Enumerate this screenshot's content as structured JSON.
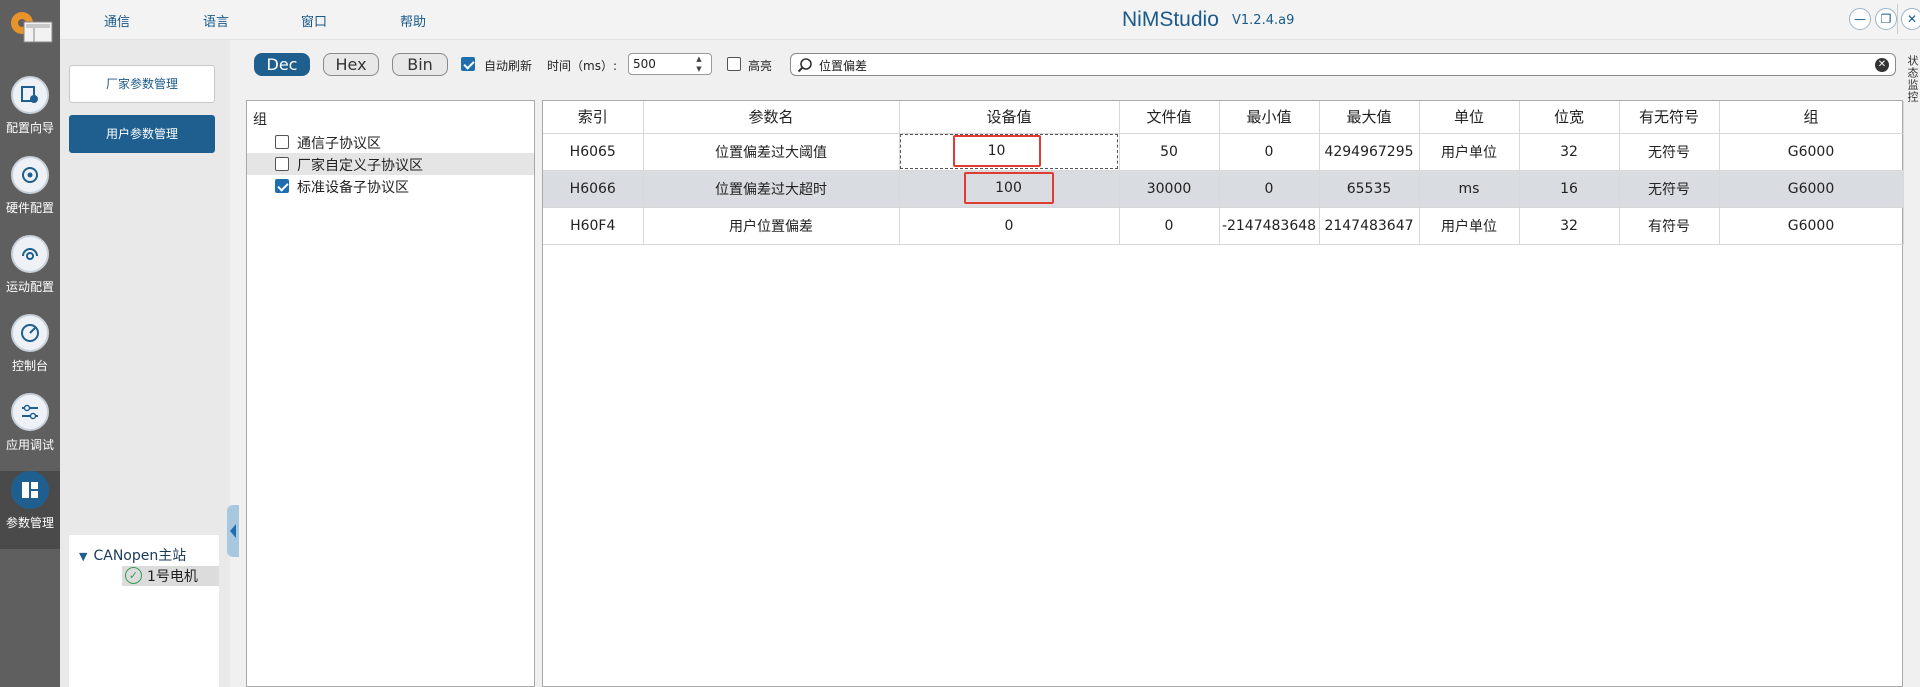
{
  "menu": {
    "comm": "通信",
    "lang": "语言",
    "window": "窗口",
    "help": "帮助"
  },
  "app": {
    "title": "NiMStudio",
    "version": "V1.2.4.a9"
  },
  "rail": [
    {
      "label": "配置向导",
      "icon": "config-wizard-icon"
    },
    {
      "label": "硬件配置",
      "icon": "hardware-config-icon"
    },
    {
      "label": "运动配置",
      "icon": "motion-config-icon"
    },
    {
      "label": "控制台",
      "icon": "console-gauge-icon"
    },
    {
      "label": "应用调试",
      "icon": "app-debug-sliders-icon"
    },
    {
      "label": "参数管理",
      "icon": "param-manage-icon"
    }
  ],
  "side": {
    "vendor_btn": "厂家参数管理",
    "user_btn": "用户参数管理"
  },
  "tree": {
    "root": "CANopen主站",
    "child": "1号电机"
  },
  "toolbar": {
    "dec": "Dec",
    "hex": "Hex",
    "bin": "Bin",
    "auto_refresh": "自动刷新",
    "interval_label": "时间（ms）:",
    "interval_value": "500",
    "highlight": "高亮",
    "search_value": "位置偏差"
  },
  "right_tab": "状态监控",
  "groups": {
    "title": "组",
    "items": [
      {
        "label": "通信子协议区",
        "checked": false
      },
      {
        "label": "厂家自定义子协议区",
        "checked": false
      },
      {
        "label": "标准设备子协议区",
        "checked": true
      }
    ]
  },
  "table": {
    "headers": [
      "索引",
      "参数名",
      "设备值",
      "文件值",
      "最小值",
      "最大值",
      "单位",
      "位宽",
      "有无符号",
      "组"
    ],
    "rows": [
      [
        "H6065",
        "位置偏差过大阈值",
        "10",
        "50",
        "0",
        "4294967295",
        "用户单位",
        "32",
        "无符号",
        "G6000"
      ],
      [
        "H6066",
        "位置偏差过大超时",
        "100",
        "30000",
        "0",
        "65535",
        "ms",
        "16",
        "无符号",
        "G6000"
      ],
      [
        "H60F4",
        "用户位置偏差",
        "0",
        "0",
        "-2147483648",
        "2147483647",
        "用户单位",
        "32",
        "有符号",
        "G6000"
      ]
    ]
  }
}
